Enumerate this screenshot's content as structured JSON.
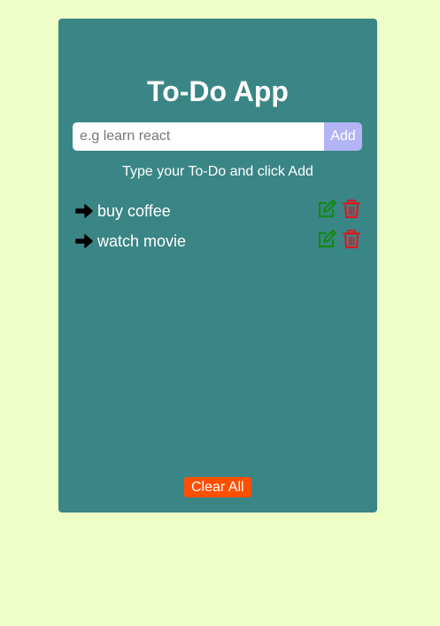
{
  "app": {
    "title": "To-Do App",
    "hint": "Type your To-Do and click Add"
  },
  "input": {
    "placeholder": "e.g learn react",
    "value": "",
    "add_label": "Add"
  },
  "todos": [
    {
      "text": "buy coffee"
    },
    {
      "text": "watch movie"
    }
  ],
  "icons": {
    "bullet": "arrow-right-icon",
    "edit": "edit-icon",
    "delete": "trash-icon"
  },
  "colors": {
    "page_background": "#eefec6",
    "card_background": "#3a8585",
    "add_button": "#b3b4f6",
    "edit_icon": "#138a13",
    "delete_icon": "#e0161e",
    "clear_button": "#ff4f00"
  },
  "footer": {
    "clear_label": "Clear All"
  }
}
